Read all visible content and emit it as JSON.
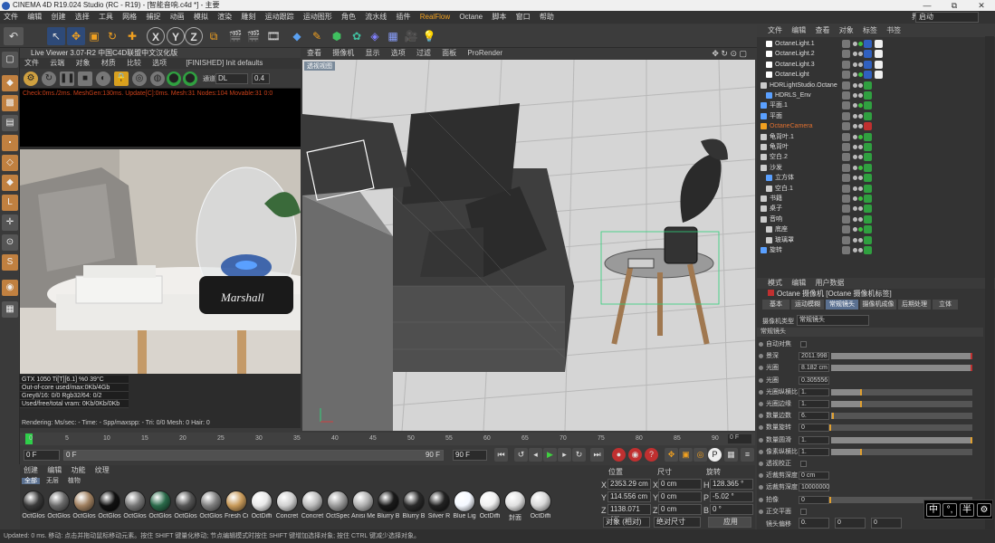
{
  "window": {
    "title": "CINEMA 4D R19.024 Studio (RC - R19) - [智能音响.c4d *] - 主要",
    "minimize": "—",
    "maximize": "⧉",
    "close": "✕"
  },
  "menubar": {
    "items": [
      "文件",
      "编辑",
      "创建",
      "选择",
      "工具",
      "网格",
      "捕捉",
      "动画",
      "模拟",
      "渲染",
      "雕刻",
      "运动跟踪",
      "运动图形",
      "角色",
      "流水线",
      "插件",
      "RealFlow",
      "Octane",
      "脚本",
      "窗口",
      "帮助"
    ],
    "layout_label": "界面:",
    "layout_value": "启动"
  },
  "live_viewer": {
    "title": "Live Viewer 3.07-R2 中国C4D联盟中文汉化版",
    "menu": [
      "文件",
      "云端",
      "对象",
      "材质",
      "比较",
      "选项"
    ],
    "status": "[FINISHED] Init defaults",
    "channel": "DL",
    "zoom": "0.4",
    "log": "Check:0ms./2ms. MeshGen:130ms. Update[C]:0ms. Mesh:31 Nodes:104 Movable:31  0:0",
    "stats": [
      "GTX 1050 Ti[T][6.1]        %0     39°C",
      "Out-of-core used/max:0Kb/4Gb",
      "Grey8/16: 0/0          Rgb32/64: 0/2",
      "Used/free/total vram: 0Kb/0Kb/0Kb"
    ],
    "render_line": "Rendering:    Ms/sec: -    Time: -     Spp/maxspp: -    Tri: 0/0    Mesh: 0     Hair: 0",
    "brand_text": "Marshall"
  },
  "viewport": {
    "menu": [
      "查看",
      "摄像机",
      "显示",
      "选项",
      "过滤",
      "面板",
      "ProRender"
    ],
    "label": "透视视图"
  },
  "timeline": {
    "ticks": [
      "0",
      "5",
      "10",
      "15",
      "20",
      "25",
      "30",
      "35",
      "40",
      "45",
      "50",
      "55",
      "60",
      "65",
      "70",
      "75",
      "80",
      "85",
      "90"
    ],
    "frame_end_label": "0 F",
    "start": "0 F",
    "current": "0 F",
    "end_a": "90 F",
    "end_b": "90 F"
  },
  "material_panel": {
    "menu": [
      "创建",
      "编辑",
      "功能",
      "纹理"
    ],
    "filters": [
      "全部",
      "无层",
      "植物"
    ],
    "materials": [
      {
        "name": "OctGlos",
        "color": "#3a3a3a"
      },
      {
        "name": "OctGlos",
        "color": "#6a6a6a"
      },
      {
        "name": "OctGlos",
        "color": "#a08060"
      },
      {
        "name": "OctGlos",
        "color": "#111111"
      },
      {
        "name": "OctGlos",
        "color": "#777777"
      },
      {
        "name": "OctGlos",
        "color": "#2a6a4a"
      },
      {
        "name": "OctGlos",
        "color": "#555555"
      },
      {
        "name": "OctGlos",
        "color": "#808080"
      },
      {
        "name": "Fresh Cu",
        "color": "#c89a5a"
      },
      {
        "name": "OctDiffi",
        "color": "#e8e8e8"
      },
      {
        "name": "Concret",
        "color": "#d0d0d0"
      },
      {
        "name": "Concret",
        "color": "#bcbcbc"
      },
      {
        "name": "OctSpec",
        "color": "#9a9a9a"
      },
      {
        "name": "Anisi Me",
        "color": "#b0b0b0"
      },
      {
        "name": "Blurry B",
        "color": "#1a1a1a"
      },
      {
        "name": "Blurry B",
        "color": "#2a2a2a"
      },
      {
        "name": "Silver R",
        "color": "#222222"
      },
      {
        "name": "Blue Lig",
        "color": "#f4f8ff"
      },
      {
        "name": "OctDiffi",
        "color": "#f0f0f0"
      },
      {
        "name": "封面",
        "color": "#e0e0e0"
      },
      {
        "name": "OctDiffi",
        "color": "#d8d8d8"
      }
    ]
  },
  "coordinates": {
    "headers": [
      "位置",
      "尺寸",
      "旋转"
    ],
    "rows": [
      {
        "axis": "X",
        "pos": "2353.29 cm",
        "size_axis": "X",
        "size": "0 cm",
        "rot_axis": "H",
        "rot": "128.365 °"
      },
      {
        "axis": "Y",
        "pos": "114.556 cm",
        "size_axis": "Y",
        "size": "0 cm",
        "rot_axis": "P",
        "rot": "-5.02 °"
      },
      {
        "axis": "Z",
        "pos": "1138.071 cm",
        "size_axis": "Z",
        "size": "0 cm",
        "rot_axis": "B",
        "rot": "0 °"
      }
    ],
    "mode1": "对象 (相对)",
    "mode2": "绝对尺寸",
    "apply": "应用"
  },
  "object_manager": {
    "menu": [
      "文件",
      "编辑",
      "查看",
      "对象",
      "标签",
      "书签"
    ],
    "objects": [
      {
        "name": "OctaneLight.1",
        "icon": "light",
        "selected": false
      },
      {
        "name": "OctaneLight.2",
        "icon": "light",
        "selected": false
      },
      {
        "name": "OctaneLight.3",
        "icon": "light",
        "selected": false
      },
      {
        "name": "OctaneLight",
        "icon": "light",
        "selected": false
      },
      {
        "name": "HDRLightStudio.Octane",
        "icon": "null",
        "selected": false
      },
      {
        "name": "HDRLS_Env",
        "icon": "env",
        "selected": false
      },
      {
        "name": "平面.1",
        "icon": "plane",
        "selected": false
      },
      {
        "name": "平面",
        "icon": "plane",
        "selected": false
      },
      {
        "name": "OctaneCamera",
        "icon": "camera",
        "selected": true
      },
      {
        "name": "龟背叶.1",
        "icon": "null",
        "selected": false
      },
      {
        "name": "龟背叶",
        "icon": "null",
        "selected": false
      },
      {
        "name": "空白.2",
        "icon": "null",
        "selected": false
      },
      {
        "name": "沙发",
        "icon": "null",
        "selected": false
      },
      {
        "name": "立方体",
        "icon": "cube",
        "selected": false
      },
      {
        "name": "空白.1",
        "icon": "null",
        "selected": false
      },
      {
        "name": "书籍",
        "icon": "null",
        "selected": false
      },
      {
        "name": "桌子",
        "icon": "null",
        "selected": false
      },
      {
        "name": "音响",
        "icon": "null",
        "selected": false
      },
      {
        "name": "底座",
        "icon": "null",
        "selected": false
      },
      {
        "name": "玻璃罩",
        "icon": "null",
        "selected": false
      },
      {
        "name": "旋转",
        "icon": "cube",
        "selected": false
      }
    ]
  },
  "attributes": {
    "menu": [
      "模式",
      "编辑",
      "用户数据"
    ],
    "title": "Octane 摄像机 [Octane 摄像机标签]",
    "tabs": [
      {
        "label": "基本",
        "active": false
      },
      {
        "label": "运动模糊",
        "active": false
      },
      {
        "label": "常规镜头",
        "active": true
      },
      {
        "label": "摄像机成像",
        "active": false
      },
      {
        "label": "后期处理",
        "active": false
      },
      {
        "label": "立体",
        "active": false
      }
    ],
    "camera_type_label": "摄像机类型",
    "camera_type_value": "常规镜头",
    "section": "常规镜头",
    "params": [
      {
        "label": "自动对焦",
        "value": "",
        "fill": 0
      },
      {
        "label": "景深",
        "value": "2011.998",
        "fill": 1.0,
        "accent": "#c03030"
      },
      {
        "label": "光圈",
        "value": "8.182 cm",
        "fill": 1.0,
        "accent": "#c03030"
      },
      {
        "label": "光圈",
        "value": "0.305556",
        "fill": 0
      },
      {
        "label": "光圈纵横比",
        "value": "1.",
        "fill": 0.22,
        "accent": "#e0a030"
      },
      {
        "label": "光圈边缘",
        "value": "1.",
        "fill": 0.22,
        "accent": "#e0a030"
      },
      {
        "label": "数量边数",
        "value": "6.",
        "fill": 0.02,
        "accent": "#e0a030"
      },
      {
        "label": "数量旋转",
        "value": "0",
        "fill": 0.0,
        "accent": "#e0a030"
      },
      {
        "label": "数量圆滑",
        "value": "1.",
        "fill": 1.0,
        "accent": "#e0a030"
      },
      {
        "label": "像素纵横比",
        "value": "1.",
        "fill": 0.22,
        "accent": "#e0a030"
      },
      {
        "label": "透视校正",
        "value": "",
        "fill": 0
      },
      {
        "label": "近裁剪深度",
        "value": "0 cm",
        "fill": 0
      },
      {
        "label": "远裁剪深度",
        "value": "10000000",
        "fill": 0
      },
      {
        "label": "拍像",
        "value": "0",
        "fill": 0.0,
        "accent": "#e0a030"
      },
      {
        "label": "正交平面",
        "value": "",
        "fill": 0
      }
    ],
    "shift_label": "镜头偏移",
    "shift_values": [
      "0.",
      "0",
      "0"
    ]
  },
  "ime": {
    "items": [
      "中",
      "°,",
      "半",
      "⚙"
    ]
  },
  "statusbar": {
    "text": "Updated: 0 ms.   移动: 点击并拖动鼠标移动元素。按住 SHIFT 键量化移动; 节点编辑模式时按住 SHIFT 键增加选择对象; 按住 CTRL 键减少选择对象。"
  },
  "colors": {
    "selected": "#e07030",
    "accent": "#5a7090",
    "panel": "#333333"
  }
}
